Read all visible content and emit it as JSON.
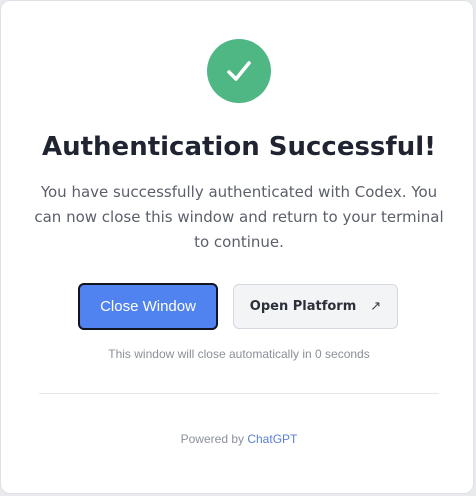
{
  "status": {
    "icon": "check-icon",
    "color": "#4fb784"
  },
  "title": "Authentication Successful!",
  "message": "You have successfully authenticated with Codex. You can now close this window and return to your terminal to continue.",
  "buttons": {
    "close_label": "Close Window",
    "close_color": "#5082f0",
    "open_label": "Open Platform",
    "open_icon": "external-link-icon"
  },
  "countdown": {
    "prefix": "This window will close automatically in ",
    "seconds": "0",
    "suffix": " seconds"
  },
  "footer": {
    "powered_by": "Powered by",
    "link_text": "ChatGPT",
    "link_color": "#5b7fd6"
  }
}
